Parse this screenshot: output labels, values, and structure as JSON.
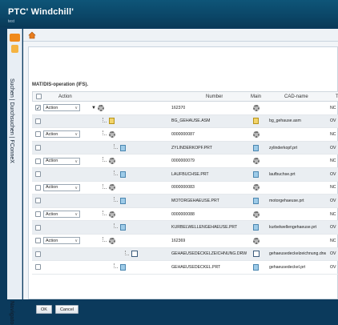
{
  "app": {
    "brand": "PTC' Windchill'",
    "sub": "test"
  },
  "left_rail": {
    "search_label": "Suchen | Durchsuchen | FConneX",
    "nav_label": "Navigato"
  },
  "pane": {
    "title": "MAT/DIS-operation (IFS)."
  },
  "grid": {
    "headers": {
      "action": "Action",
      "number": "Number",
      "main": "Main",
      "cad": "CAD-name",
      "tail": "T"
    },
    "rows": [
      {
        "checked": true,
        "action": "Action",
        "toggle": "▼",
        "kind": "gear",
        "indent": 0,
        "number": "162370",
        "main": "gear",
        "cad": "",
        "tail": "NC",
        "alt": false
      },
      {
        "checked": false,
        "action": "",
        "toggle": "",
        "kind": "asm",
        "indent": 1,
        "number": "BG_GEHAUSE.ASM",
        "main": "asm",
        "cad": "bg_gehause.asm",
        "tail": "OV",
        "alt": true
      },
      {
        "checked": false,
        "action": "Action",
        "toggle": "",
        "kind": "gear",
        "indent": 1,
        "number": "0000000087",
        "main": "gear",
        "cad": "",
        "tail": "NC",
        "alt": false
      },
      {
        "checked": false,
        "action": "",
        "toggle": "",
        "kind": "doc",
        "indent": 2,
        "number": "ZYLINDERKOPF.PRT",
        "main": "doc",
        "cad": "zylinderkopf.prt",
        "tail": "OV",
        "alt": true
      },
      {
        "checked": false,
        "action": "Action",
        "toggle": "",
        "kind": "gear",
        "indent": 1,
        "number": "0000000079",
        "main": "gear",
        "cad": "",
        "tail": "NC",
        "alt": false
      },
      {
        "checked": false,
        "action": "",
        "toggle": "",
        "kind": "doc",
        "indent": 2,
        "number": "LAUFBUCHSE.PRT",
        "main": "doc",
        "cad": "laufbuchse.prt",
        "tail": "OV",
        "alt": true
      },
      {
        "checked": false,
        "action": "Action",
        "toggle": "",
        "kind": "gear",
        "indent": 1,
        "number": "0000000083",
        "main": "gear",
        "cad": "",
        "tail": "NC",
        "alt": false
      },
      {
        "checked": false,
        "action": "",
        "toggle": "",
        "kind": "doc",
        "indent": 2,
        "number": "MOTORGEHAEUSE.PRT",
        "main": "doc",
        "cad": "motorgehaeuse.prt",
        "tail": "OV",
        "alt": true
      },
      {
        "checked": false,
        "action": "Action",
        "toggle": "",
        "kind": "gear",
        "indent": 1,
        "number": "0000000088",
        "main": "gear",
        "cad": "",
        "tail": "NC",
        "alt": false
      },
      {
        "checked": false,
        "action": "",
        "toggle": "",
        "kind": "doc",
        "indent": 2,
        "number": "KURBELWELLENGEHAEUSE.PRT",
        "main": "doc",
        "cad": "kurbelwellengehaeuse.prt",
        "tail": "OV",
        "alt": true
      },
      {
        "checked": false,
        "action": "Action",
        "toggle": "",
        "kind": "gear",
        "indent": 1,
        "number": "162369",
        "main": "gear",
        "cad": "",
        "tail": "NC",
        "alt": false
      },
      {
        "checked": false,
        "action": "",
        "toggle": "",
        "kind": "drw",
        "indent": 3,
        "number": "GEHAEUSEDECKELZEICHNUNG.DRW",
        "main": "drw",
        "cad": "gehaeusedeckelzeichnung.drw",
        "tail": "OV",
        "alt": true
      },
      {
        "checked": false,
        "action": "",
        "toggle": "",
        "kind": "doc",
        "indent": 2,
        "number": "GEHAEUSEDECKEL.PRT",
        "main": "doc",
        "cad": "gehaeusedeckel.prt",
        "tail": "OV",
        "alt": false
      }
    ]
  },
  "buttons": {
    "ok": "OK",
    "cancel": "Cancel"
  },
  "colors": {
    "header_bg": "#0b4667",
    "accent": "#f08a1c"
  }
}
